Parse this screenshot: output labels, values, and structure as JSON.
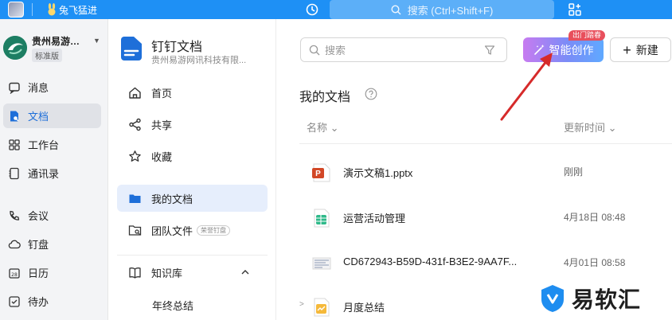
{
  "topbar": {
    "user_name": "兔飞猛进",
    "search_placeholder": "搜索 (Ctrl+Shift+F)"
  },
  "org": {
    "name": "贵州易游…",
    "badge": "标准版"
  },
  "leftnav": {
    "items": [
      {
        "label": "消息"
      },
      {
        "label": "文档"
      },
      {
        "label": "工作台"
      },
      {
        "label": "通讯录"
      },
      {
        "label": "会议"
      },
      {
        "label": "钉盘"
      },
      {
        "label": "日历"
      },
      {
        "label": "待办"
      }
    ]
  },
  "docs_sidebar": {
    "title": "钉钉文档",
    "subtitle": "贵州易游网讯科技有限...",
    "items": [
      {
        "label": "首页"
      },
      {
        "label": "共享"
      },
      {
        "label": "收藏"
      },
      {
        "label": "我的文档"
      },
      {
        "label": "团队文件",
        "tag": "荣誉钉盘"
      },
      {
        "label": "知识库"
      }
    ],
    "knowledge_sub": "年终总结"
  },
  "main": {
    "search_placeholder": "搜索",
    "ai_button": "智能创作",
    "ai_badge": "出门踏春",
    "new_button": "新建",
    "section_title": "我的文档",
    "col_name": "名称",
    "col_time": "更新时间",
    "files": [
      {
        "name": "演示文稿1.pptx",
        "time": "刚刚",
        "type": "ppt"
      },
      {
        "name": "运营活动管理",
        "time": "4月18日 08:48",
        "type": "sheet"
      },
      {
        "name": "CD672943-B59D-431f-B3E2-9AA7F...",
        "time": "4月01日 08:58",
        "type": "image"
      },
      {
        "name": "月度总结",
        "time": "",
        "type": "folder"
      }
    ]
  },
  "watermark": {
    "text": "易软汇"
  },
  "colors": {
    "topbar": "#1e90f5",
    "active_blue": "#1e6fd9",
    "annotation_red": "#d62a2a",
    "badge_red": "#e84f5c"
  }
}
